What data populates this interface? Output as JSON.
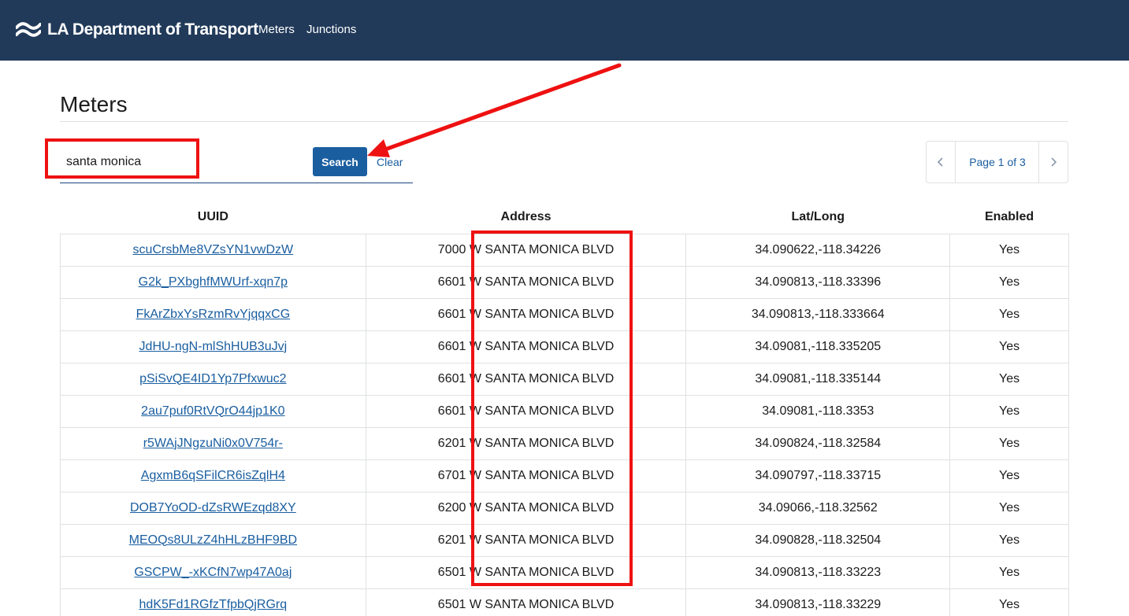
{
  "header": {
    "brand": "LA Department of Transport",
    "nav": [
      {
        "label": "Meters"
      },
      {
        "label": "Junctions"
      }
    ],
    "background_color": "#213a5a"
  },
  "page": {
    "title": "Meters"
  },
  "search": {
    "value": "santa monica",
    "button_label": "Search",
    "clear_label": "Clear"
  },
  "pagination": {
    "label": "Page 1 of 3",
    "prev_icon": "chevron-left-icon",
    "next_icon": "chevron-right-icon"
  },
  "table": {
    "columns": [
      "UUID",
      "Address",
      "Lat/Long",
      "Enabled"
    ],
    "rows": [
      {
        "uuid": "scuCrsbMe8VZsYN1vwDzW",
        "address": "7000 W SANTA MONICA BLVD",
        "latlong": "34.090622,-118.34226",
        "enabled": "Yes"
      },
      {
        "uuid": "G2k_PXbghfMWUrf-xqn7p",
        "address": "6601 W SANTA MONICA BLVD",
        "latlong": "34.090813,-118.33396",
        "enabled": "Yes"
      },
      {
        "uuid": "FkArZbxYsRzmRvYjqqxCG",
        "address": "6601 W SANTA MONICA BLVD",
        "latlong": "34.090813,-118.333664",
        "enabled": "Yes"
      },
      {
        "uuid": "JdHU-ngN-mlShHUB3uJvj",
        "address": "6601 W SANTA MONICA BLVD",
        "latlong": "34.09081,-118.335205",
        "enabled": "Yes"
      },
      {
        "uuid": "pSiSvQE4ID1Yp7Pfxwuc2",
        "address": "6601 W SANTA MONICA BLVD",
        "latlong": "34.09081,-118.335144",
        "enabled": "Yes"
      },
      {
        "uuid": "2au7puf0RtVQrO44jp1K0",
        "address": "6601 W SANTA MONICA BLVD",
        "latlong": "34.09081,-118.3353",
        "enabled": "Yes"
      },
      {
        "uuid": "r5WAjJNgzuNi0x0V754r-",
        "address": "6201 W SANTA MONICA BLVD",
        "latlong": "34.090824,-118.32584",
        "enabled": "Yes"
      },
      {
        "uuid": "AgxmB6qSFilCR6isZqlH4",
        "address": "6701 W SANTA MONICA BLVD",
        "latlong": "34.090797,-118.33715",
        "enabled": "Yes"
      },
      {
        "uuid": "DOB7YoOD-dZsRWEzqd8XY",
        "address": "6200 W SANTA MONICA BLVD",
        "latlong": "34.09066,-118.32562",
        "enabled": "Yes"
      },
      {
        "uuid": "MEOQs8ULzZ4hHLzBHF9BD",
        "address": "6201 W SANTA MONICA BLVD",
        "latlong": "34.090828,-118.32504",
        "enabled": "Yes"
      },
      {
        "uuid": "GSCPW_-xKCfN7wp47A0aj",
        "address": "6501 W SANTA MONICA BLVD",
        "latlong": "34.090813,-118.33223",
        "enabled": "Yes"
      },
      {
        "uuid": "hdK5Fd1RGfzTfpbQjRGrq",
        "address": "6501 W SANTA MONICA BLVD",
        "latlong": "34.090813,-118.33229",
        "enabled": "Yes"
      }
    ]
  },
  "colors": {
    "accent": "#1a5ea0",
    "annotation": "#ee1111"
  }
}
